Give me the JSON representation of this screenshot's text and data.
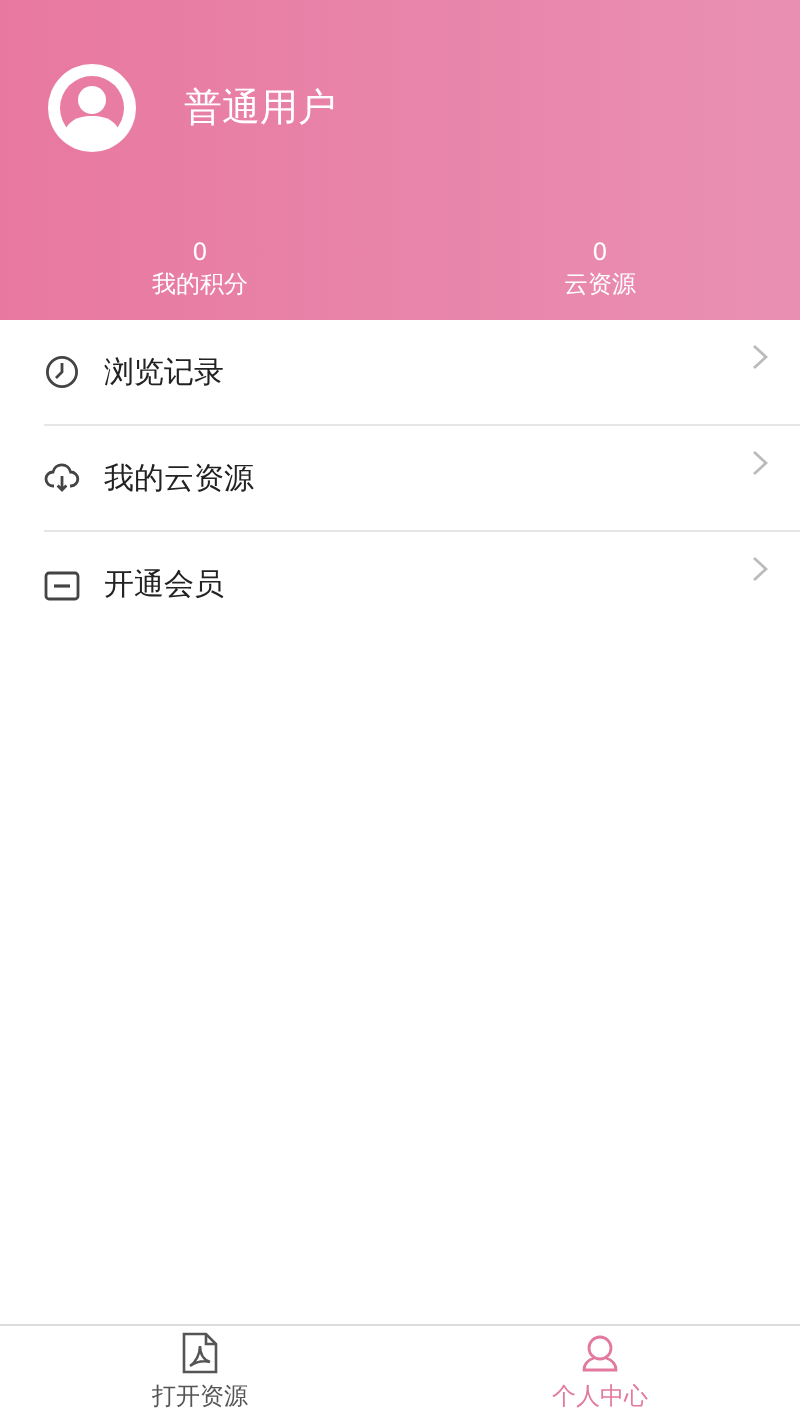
{
  "profile": {
    "name": "普通用户"
  },
  "stats": [
    {
      "value": "0",
      "label": "我的积分"
    },
    {
      "value": "0",
      "label": "云资源"
    }
  ],
  "menu": [
    {
      "kind": "history",
      "label": "浏览记录"
    },
    {
      "kind": "cloud",
      "label": "我的云资源"
    },
    {
      "kind": "vip",
      "label": "开通会员"
    }
  ],
  "tabs": [
    {
      "kind": "file",
      "label": "打开资源",
      "selected": false
    },
    {
      "kind": "user",
      "label": "个人中心",
      "selected": true
    }
  ]
}
